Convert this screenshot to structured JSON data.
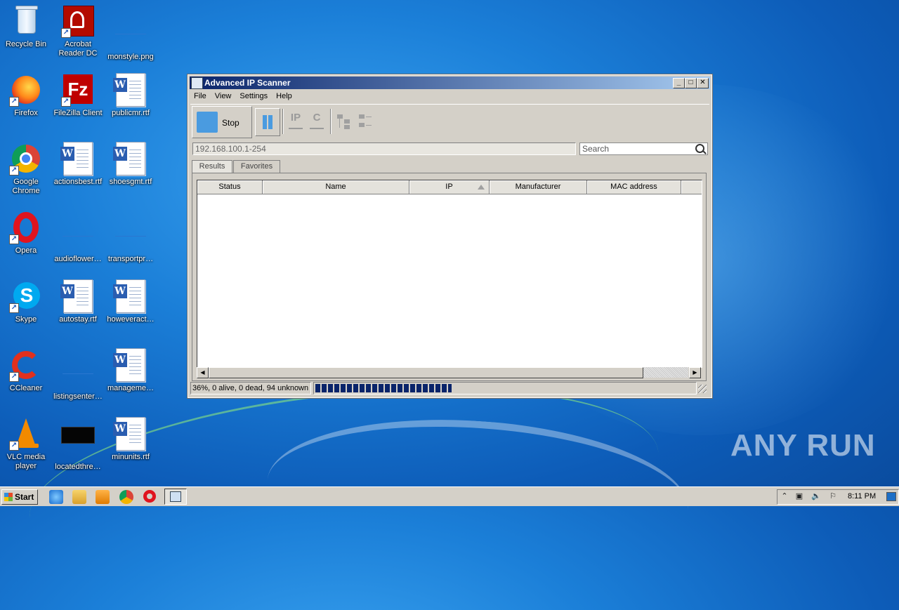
{
  "desktop": {
    "icons": [
      {
        "label": "Recycle Bin"
      },
      {
        "label": "Acrobat Reader DC"
      },
      {
        "label": "monstyle.png"
      },
      {
        "label": "Firefox"
      },
      {
        "label": "FileZilla Client"
      },
      {
        "label": "publicmr.rtf"
      },
      {
        "label": "Google Chrome"
      },
      {
        "label": "actionsbest.rtf"
      },
      {
        "label": "shoesgmt.rtf"
      },
      {
        "label": "Opera"
      },
      {
        "label": "audioflower…"
      },
      {
        "label": "transportpr…"
      },
      {
        "label": "Skype"
      },
      {
        "label": "autostay.rtf"
      },
      {
        "label": "howeveract…"
      },
      {
        "label": "CCleaner"
      },
      {
        "label": "listingsenter…"
      },
      {
        "label": "manageme…"
      },
      {
        "label": "VLC media player"
      },
      {
        "label": "locatedthre…"
      },
      {
        "label": "minunits.rtf"
      }
    ],
    "watermark": "ANY RUN"
  },
  "window": {
    "title": "Advanced IP Scanner",
    "menu": [
      "File",
      "View",
      "Settings",
      "Help"
    ],
    "toolbar": {
      "stop_label": "Stop",
      "ip_label": "IP",
      "c_label": "C"
    },
    "range_value": "192.168.100.1-254",
    "search_placeholder": "Search",
    "tabs": [
      {
        "label": "Results",
        "active": true
      },
      {
        "label": "Favorites",
        "active": false
      }
    ],
    "columns": [
      "Status",
      "Name",
      "IP",
      "Manufacturer",
      "MAC address"
    ],
    "status_text": "36%, 0 alive, 0 dead, 94 unknown",
    "progress": 36
  },
  "taskbar": {
    "start_label": "Start",
    "clock": "8:11 PM"
  }
}
